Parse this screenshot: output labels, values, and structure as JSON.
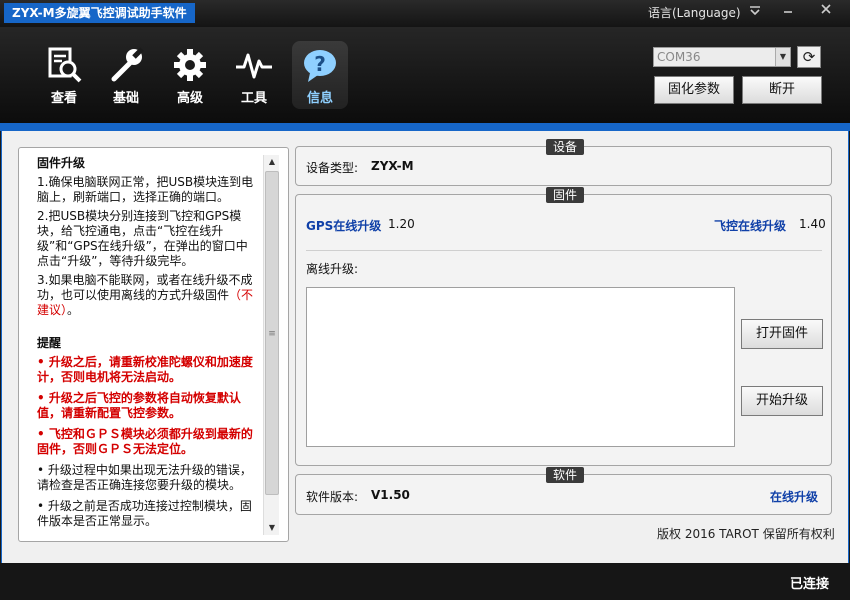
{
  "window": {
    "title": "ZYX-M多旋翼飞控调试助手软件",
    "language_label": "语言(Language)"
  },
  "nav": {
    "items": [
      {
        "label": "查看",
        "icon": "magnifier-document-icon"
      },
      {
        "label": "基础",
        "icon": "wrench-icon"
      },
      {
        "label": "高级",
        "icon": "gear-icon"
      },
      {
        "label": "工具",
        "icon": "pulse-icon"
      },
      {
        "label": "信息",
        "icon": "info-bubble-icon",
        "active": true
      }
    ]
  },
  "connection": {
    "port": "COM36",
    "save_params_label": "固化参数",
    "disconnect_label": "断开"
  },
  "help": {
    "firmware_heading": "固件升级",
    "steps": [
      "1.确保电脑联网正常，把USB模块连到电脑上，刷新端口，选择正确的端口。",
      "2.把USB模块分别连接到飞控和GPS模块，给飞控通电，点击“飞控在线升级”和“GPS在线升级”，在弹出的窗口中点击“升级”，等待升级完毕。"
    ],
    "step3_main": "3.如果电脑不能联网，或者在线升级不成功，也可以使用离线的方式升级固件",
    "step3_note": "（不建议）",
    "step3_end": "。",
    "reminder_heading": "提醒",
    "reminders_red": [
      "• 升级之后，请重新校准陀螺仪和加速度计，否则电机将无法启动。",
      "• 升级之后飞控的参数将自动恢复默认值，请重新配置飞控参数。",
      "• 飞控和ＧＰＳ模块必须都升级到最新的固件，否则ＧＰＳ无法定位。"
    ],
    "reminders": [
      "• 升级过程中如果出现无法升级的错误，请检查是否正确连接您要升级的模块。",
      "• 升级之前是否成功连接过控制模块，固件版本是否正常显示。"
    ]
  },
  "device": {
    "group_title": "设备",
    "type_label": "设备类型:",
    "type_value": "ZYX-M"
  },
  "firmware": {
    "group_title": "固件",
    "gps_upgrade_label": "GPS在线升级",
    "gps_version": "1.20",
    "fc_upgrade_label": "飞控在线升级",
    "fc_version": "1.40",
    "offline_label": "离线升级:",
    "open_firmware_label": "打开固件",
    "start_upgrade_label": "开始升级"
  },
  "software": {
    "group_title": "软件",
    "version_label": "软件版本:",
    "version_value": "V1.50",
    "online_upgrade_label": "在线升级"
  },
  "copyright": "版权 2016 TAROT 保留所有权利",
  "status": "已连接"
}
